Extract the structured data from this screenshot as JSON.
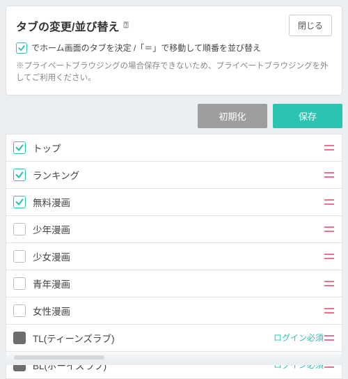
{
  "header": {
    "title": "タブの変更/並び替え",
    "close": "閉じる",
    "subtitle_prefix": "",
    "subtitle_text": "でホーム画面のタブを決定 /「＝」で移動して順番を並び替え",
    "warning": "※プライベートブラウジングの場合保存できないため、プライベートブラウジングを外してご利用ください。"
  },
  "actions": {
    "reset": "初期化",
    "save": "保存"
  },
  "login_required_text": "ログイン必須",
  "items": [
    {
      "label": "トップ",
      "checked": true,
      "login": false,
      "disabled": false
    },
    {
      "label": "ランキング",
      "checked": true,
      "login": false,
      "disabled": false
    },
    {
      "label": "無料漫画",
      "checked": true,
      "login": false,
      "disabled": false
    },
    {
      "label": "少年漫画",
      "checked": false,
      "login": false,
      "disabled": false
    },
    {
      "label": "少女漫画",
      "checked": false,
      "login": false,
      "disabled": false
    },
    {
      "label": "青年漫画",
      "checked": false,
      "login": false,
      "disabled": false
    },
    {
      "label": "女性漫画",
      "checked": false,
      "login": false,
      "disabled": false
    },
    {
      "label": "TL(ティーンズラブ)",
      "checked": false,
      "login": true,
      "disabled": true
    },
    {
      "label": "BL(ボーイズラブ)",
      "checked": false,
      "login": true,
      "disabled": true
    }
  ]
}
